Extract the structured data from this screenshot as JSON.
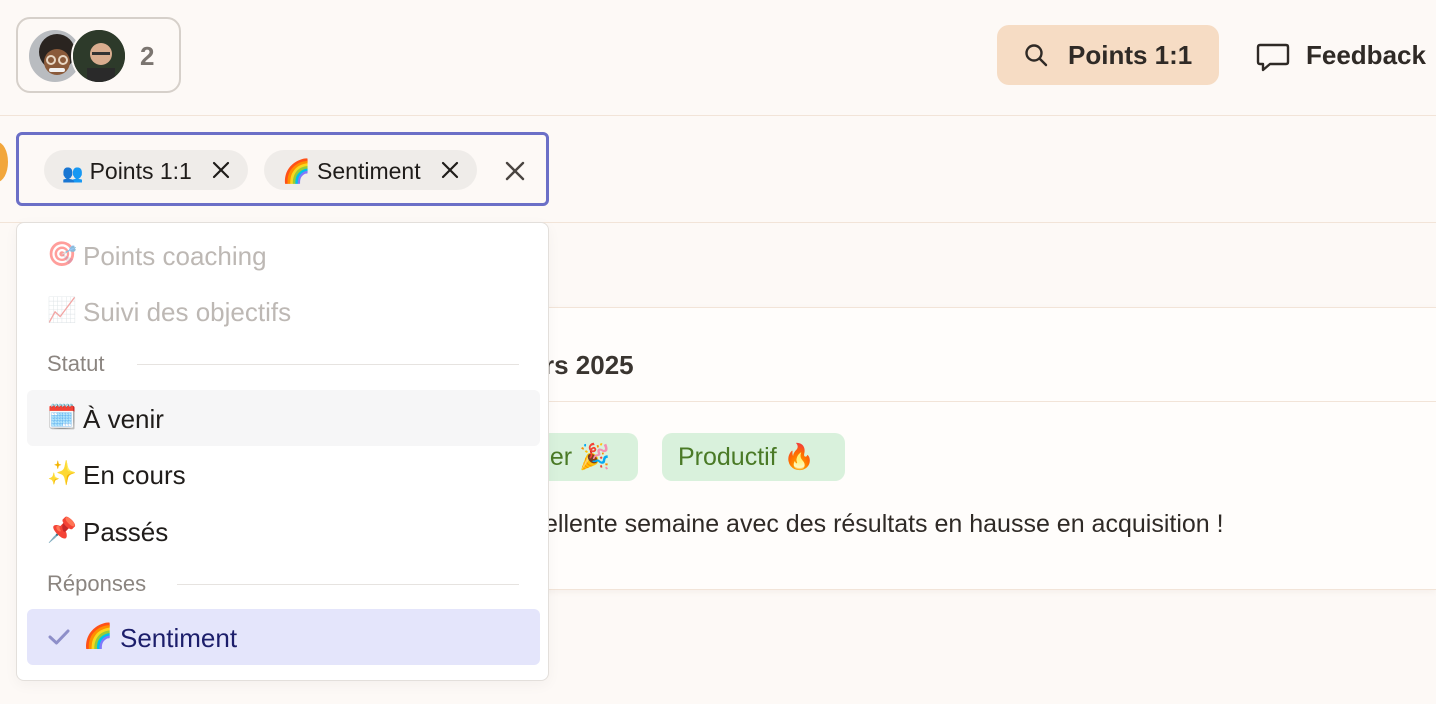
{
  "header": {
    "participants_count": "2",
    "search_label": "Points 1:1",
    "feedback_label": "Feedback"
  },
  "filter": {
    "tags": [
      {
        "emoji": "👥",
        "label": "Points 1:1"
      },
      {
        "emoji": "🌈",
        "label": "Sentiment"
      }
    ]
  },
  "dropdown": {
    "items_top": [
      {
        "emoji": "🎯",
        "label": "Points coaching"
      },
      {
        "emoji": "📈",
        "label": "Suivi des objectifs"
      }
    ],
    "section_statut": "Statut",
    "statut_items": [
      {
        "emoji": "🗓️",
        "label": "À venir"
      },
      {
        "emoji": "✨",
        "label": "En cours"
      },
      {
        "emoji": "📌",
        "label": "Passés"
      }
    ],
    "section_reponses": "Réponses",
    "reponses_items": [
      {
        "emoji": "🌈",
        "label": "Sentiment"
      }
    ]
  },
  "card": {
    "title_visible": "rs 2025",
    "badges": [
      "per 🎉",
      "Productif 🔥"
    ],
    "text_visible": "ellente semaine avec des résultats en hausse en acquisition !"
  },
  "colors": {
    "background": "#fdf9f6",
    "search_pill": "#f6dcc4",
    "focus_border": "#6b6fc7",
    "selected_item": "#e4e5fb",
    "badge_bg": "#d9f1dc",
    "badge_text": "#4a7a26"
  }
}
